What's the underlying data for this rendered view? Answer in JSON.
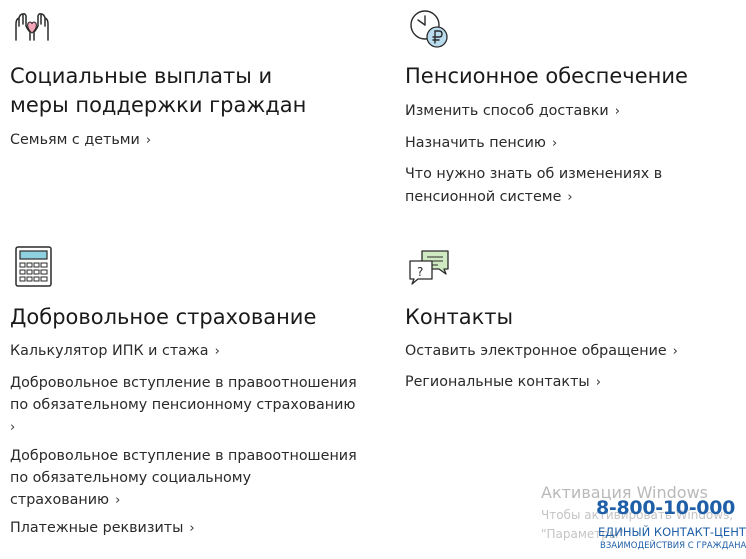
{
  "sections": {
    "social": {
      "icon": "heart-hands-icon",
      "title_line1": "Социальные выплаты и",
      "title_line2": "меры поддержки граждан",
      "links": [
        "Семьям с детьми"
      ]
    },
    "pension": {
      "icon": "clock-ruble-icon",
      "title": "Пенсионное обеспечение",
      "links": [
        "Изменить способ доставки",
        "Назначить пенсию",
        "Что нужно знать об изменениях в",
        "пенсионной системе"
      ]
    },
    "voluntary": {
      "icon": "calculator-icon",
      "title": "Добровольное страхование",
      "links": [
        "Калькулятор ИПК и стажа",
        "Добровольное вступление в правоотношения",
        "по обязательному пенсионному страхованию",
        "Добровольное вступление в правоотношения",
        "по обязательному социальному",
        "страхованию",
        "Платежные реквизиты"
      ]
    },
    "contacts": {
      "icon": "chat-bubbles-icon",
      "title": "Контакты",
      "links": [
        "Оставить электронное обращение",
        "Региональные контакты"
      ]
    }
  },
  "chevron": "›",
  "watermark": {
    "title": "Активация Windows",
    "line1": "Чтобы активировать Windows,",
    "line2": "\"Параметры\""
  },
  "banner": {
    "phone": "8-800-10-000",
    "line1": "ЕДИНЫЙ КОНТАКТ-ЦЕНТР",
    "line2": "ВЗАИМОДЕЙСТВИЯ С ГРАЖДАНАМИ"
  },
  "colors": {
    "heart": "#f3a6b8",
    "calculator_screen": "#8ecfe0",
    "chat_fill": "#cfe9c2",
    "ruble_fill": "#b8dcee",
    "banner": "#1f5fa8"
  }
}
